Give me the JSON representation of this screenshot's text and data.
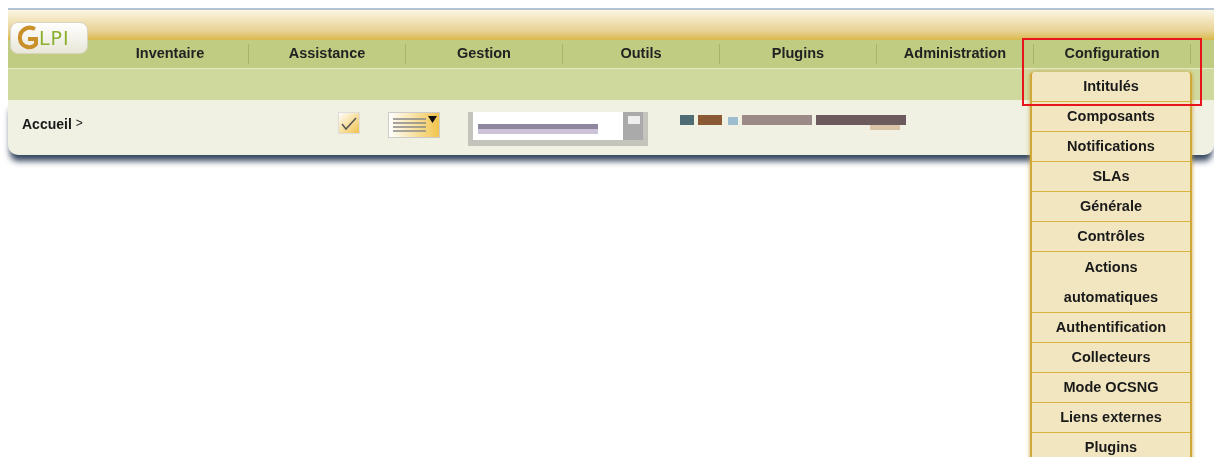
{
  "logo": {
    "text": "LPI"
  },
  "menu": [
    {
      "label": "Inventaire"
    },
    {
      "label": "Assistance"
    },
    {
      "label": "Gestion"
    },
    {
      "label": "Outils"
    },
    {
      "label": "Plugins"
    },
    {
      "label": "Administration"
    },
    {
      "label": "Configuration"
    }
  ],
  "breadcrumb": {
    "label": "Accueil",
    "separator": ">"
  },
  "dropdown": {
    "highlighted": true,
    "items": [
      {
        "label": "Intitulés"
      },
      {
        "label": "Composants"
      },
      {
        "label": "Notifications"
      },
      {
        "label": "SLAs"
      },
      {
        "label": "Générale"
      },
      {
        "label": "Contrôles"
      },
      {
        "label": "Actions automatiques"
      },
      {
        "label": "Authentification"
      },
      {
        "label": "Collecteurs"
      },
      {
        "label": "Mode OCSNG"
      },
      {
        "label": "Liens externes"
      },
      {
        "label": "Plugins"
      }
    ]
  }
}
